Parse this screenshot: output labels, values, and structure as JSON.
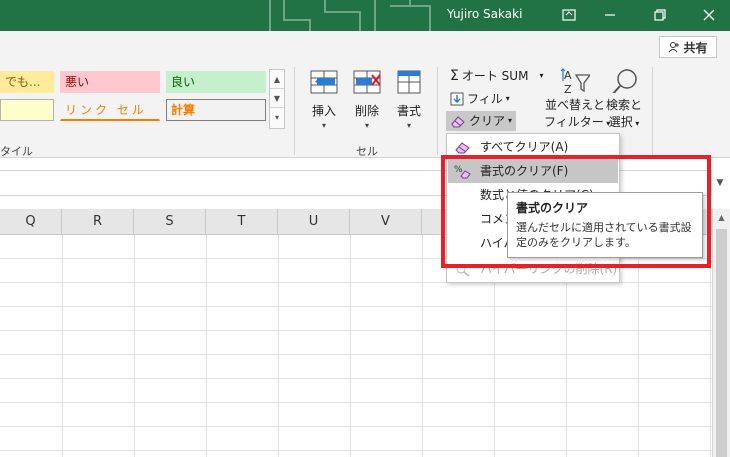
{
  "titlebar": {
    "user_name": "Yujiro Sakaki",
    "colors": {
      "background": "#217346"
    }
  },
  "ribbon": {
    "share_label": "共有",
    "styles": {
      "neutral_partial": "でも...",
      "bad": "悪い",
      "good": "良い",
      "linked_cell": "リンク セル",
      "calculation": "計算",
      "group_label_partial": "タイル",
      "colors": {
        "neutral_bg": "#ffeb9c",
        "neutral_text": "#9c5700",
        "bad_bg": "#ffc7ce",
        "bad_text": "#9c0006",
        "good_bg": "#c6efce",
        "good_text": "#006100",
        "link_text": "#fa7d00",
        "calc_bg": "#f2f2f2",
        "calc_text": "#fa7d00"
      }
    },
    "cells_group": {
      "insert_label": "挿入",
      "delete_label": "削除",
      "format_label": "書式",
      "group_label": "セル"
    },
    "editing_group": {
      "autosum_label": "オート SUM",
      "fill_label": "フィル",
      "clear_label": "クリア",
      "sort_line1": "並べ替えと",
      "sort_line2": "フィルター",
      "find_line1": "検索と",
      "find_line2": "選択"
    }
  },
  "grid": {
    "columns": [
      "Q",
      "R",
      "S",
      "T",
      "U",
      "V"
    ]
  },
  "clear_menu": {
    "items": [
      {
        "label": "すべてクリア(A)",
        "icon": "eraser-icon"
      },
      {
        "label": "書式のクリア(F)",
        "icon": "clear-format-icon",
        "highlighted": true
      },
      {
        "label": "数式と値のクリア(C)",
        "icon": ""
      },
      {
        "label": "コメントのクリア(M)",
        "icon": ""
      },
      {
        "label": "ハイパーリンクのクリア(L)",
        "icon": ""
      },
      {
        "label": "ハイパーリンクの削除(R)",
        "icon": "remove-link-icon",
        "disabled": true
      }
    ]
  },
  "tooltip": {
    "title": "書式のクリア",
    "body": "選んだセルに適用されている書式設定のみをクリアします。"
  },
  "annotation": {
    "color": "#e8202a"
  }
}
